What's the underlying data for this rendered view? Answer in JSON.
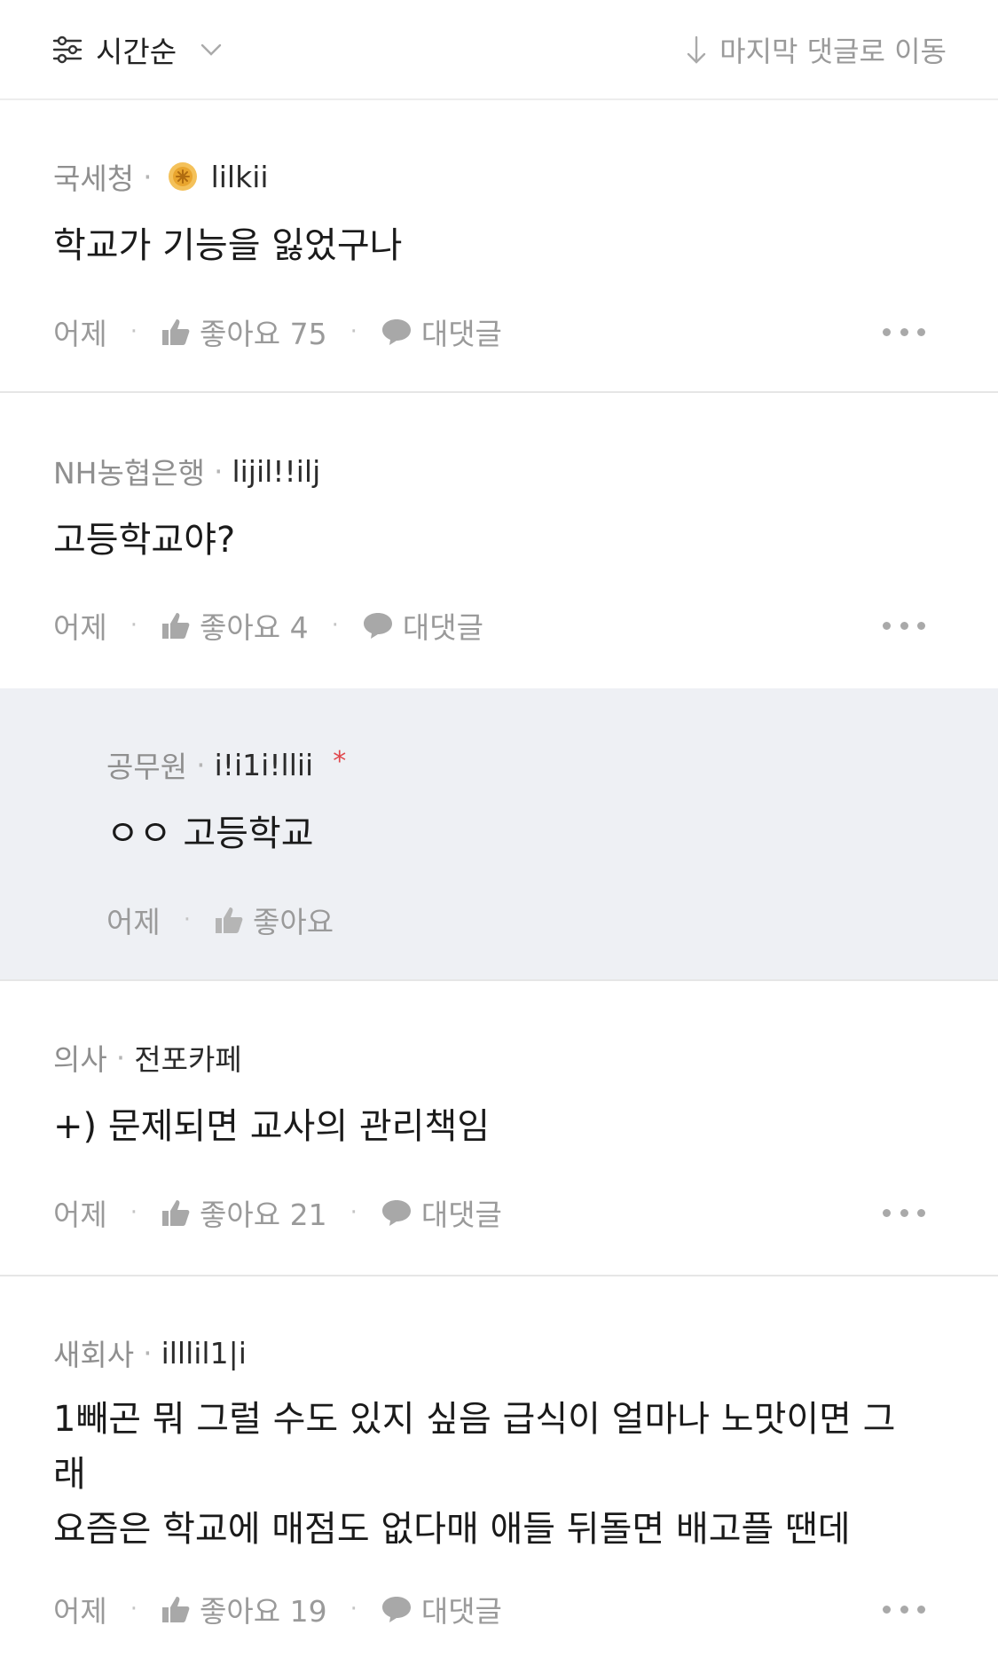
{
  "header": {
    "sort_label": "시간순",
    "jump_label": "마지막 댓글로 이동"
  },
  "comments": [
    {
      "job": "국세청",
      "nickname": "lilkii",
      "has_badge": true,
      "text": "학교가 기능을 잃었구나",
      "time": "어제",
      "like_label": "좋아요 75",
      "reply_label": "대댓글"
    },
    {
      "job": "NH농협은행",
      "nickname": "lijil!!ilj",
      "text": "고등학교야?",
      "time": "어제",
      "like_label": "좋아요 4",
      "reply_label": "대댓글"
    },
    {
      "job": "공무원",
      "nickname": "i!i1i!llii",
      "is_reply": true,
      "author_mark": "*",
      "text": "ㅇㅇ 고등학교",
      "time": "어제",
      "like_label": "좋아요"
    },
    {
      "job": "의사",
      "nickname": "전포카페",
      "text": "+) 문제되면 교사의 관리책임",
      "time": "어제",
      "like_label": "좋아요 21",
      "reply_label": "대댓글"
    },
    {
      "job": "새회사",
      "nickname": "illlil1|i",
      "text_lines": [
        "1빼곤 뭐 그럴 수도 있지 싶음 급식이 얼마나 노맛이면 그",
        "래",
        "요즘은 학교에 매점도 없다매 애들 뒤돌면 배고플 땐데"
      ],
      "time": "어제",
      "like_label": "좋아요 19",
      "reply_label": "대댓글"
    }
  ],
  "colors": {
    "reply_background": "#eef0f4",
    "meta_gray": "#8f8f8f",
    "author_mark_red": "#e0474c",
    "badge_gold": "#f1b53a"
  }
}
